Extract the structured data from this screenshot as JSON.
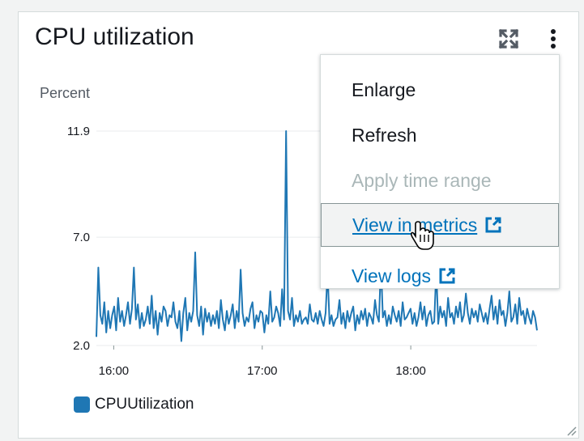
{
  "widget": {
    "title": "CPU utilization",
    "y_unit_label": "Percent",
    "expand_icon": "expand-icon",
    "more_icon": "more-vertical-icon",
    "resize_icon": "resize-handle-icon"
  },
  "chart_data": {
    "type": "line",
    "ylabel": "Percent",
    "ylim": [
      2.0,
      11.9
    ],
    "yticks": [
      "11.9",
      "7.0",
      "2.0"
    ],
    "xticks": [
      "16:00",
      "17:00",
      "18:00"
    ],
    "x_start": "15:53",
    "x_end": "18:51",
    "series": [
      {
        "name": "CPUUtilization",
        "color": "#1f77b4",
        "values": [
          2.4,
          5.6,
          3.4,
          3.0,
          4.0,
          2.6,
          3.6,
          2.8,
          3.4,
          3.8,
          2.7,
          4.2,
          3.1,
          3.6,
          2.9,
          3.4,
          4.0,
          3.0,
          3.7,
          5.6,
          3.2,
          3.9,
          2.8,
          3.5,
          2.9,
          3.2,
          3.8,
          3.0,
          4.3,
          2.8,
          3.6,
          2.5,
          3.5,
          3.1,
          3.8,
          3.6,
          2.9,
          3.4,
          3.3,
          4.0,
          3.1,
          2.8,
          3.6,
          2.2,
          3.5,
          4.2,
          2.7,
          3.5,
          3.1,
          3.6,
          6.3,
          3.4,
          2.9,
          3.8,
          2.5,
          3.7,
          3.1,
          3.5,
          2.9,
          3.4,
          3.0,
          3.6,
          2.8,
          4.1,
          3.2,
          2.7,
          3.6,
          3.0,
          3.4,
          3.9,
          2.8,
          3.6,
          3.1,
          5.5,
          3.5,
          2.9,
          3.3,
          3.1,
          3.7,
          4.0,
          2.8,
          3.4,
          3.1,
          3.6,
          3.5,
          2.6,
          3.4,
          3.0,
          4.5,
          3.1,
          3.3,
          3.8,
          3.5,
          2.9,
          4.6,
          3.2,
          11.9,
          3.6,
          3.2,
          4.2,
          2.9,
          3.4,
          3.1,
          3.6,
          3.0,
          3.2,
          3.3,
          3.0,
          3.9,
          3.2,
          3.1,
          3.5,
          3.0,
          3.6,
          3.2,
          2.9,
          3.5,
          5.4,
          3.0,
          3.4,
          2.9,
          3.2,
          3.3,
          4.1,
          3.0,
          3.5,
          2.8,
          3.6,
          3.1,
          3.5,
          3.8,
          2.7,
          3.4,
          3.0,
          3.6,
          3.2,
          3.7,
          2.9,
          3.5,
          3.3,
          3.0,
          4.1,
          3.4,
          3.1,
          5.8,
          3.3,
          3.6,
          2.9,
          3.4,
          3.0,
          3.8,
          3.4,
          3.1,
          3.6,
          2.9,
          4.0,
          3.2,
          3.3,
          3.5,
          3.7,
          3.0,
          3.5,
          2.9,
          3.3,
          4.0,
          3.2,
          3.8,
          2.9,
          3.4,
          3.6,
          3.0,
          3.1,
          5.5,
          3.0,
          3.8,
          3.3,
          3.6,
          2.9,
          4.2,
          3.3,
          3.5,
          3.0,
          3.8,
          3.3,
          4.0,
          3.1,
          3.4,
          4.4,
          3.5,
          3.0,
          3.7,
          3.3,
          3.6,
          3.1,
          3.9,
          3.5,
          3.1,
          3.5,
          3.0,
          3.7,
          4.3,
          3.2,
          3.8,
          3.0,
          4.1,
          3.4,
          3.6,
          2.9,
          3.5,
          4.5,
          3.1,
          3.3,
          3.9,
          3.0,
          4.2,
          3.4,
          3.6,
          3.0,
          3.7,
          3.3,
          3.0,
          3.6,
          3.3,
          2.7
        ]
      }
    ],
    "legend": "bottom-left"
  },
  "menu": {
    "items": [
      {
        "label": "Enlarge",
        "state": "normal"
      },
      {
        "label": "Refresh",
        "state": "normal"
      },
      {
        "label": "Apply time range",
        "state": "disabled"
      },
      {
        "label": "View in metrics",
        "state": "link-hover",
        "icon": "external-link-icon"
      },
      {
        "label": "View logs",
        "state": "link",
        "icon": "external-link-icon"
      }
    ]
  },
  "cursor_icon": "hand-pointer-icon"
}
